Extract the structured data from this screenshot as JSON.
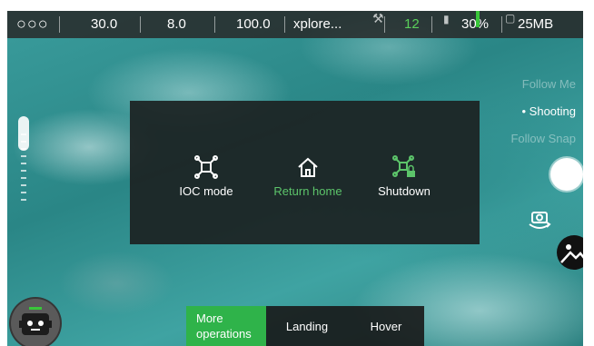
{
  "topbar": {
    "values": [
      "30.0",
      "8.0",
      "100.0",
      "xplore...",
      "12",
      "30%",
      "25MB"
    ]
  },
  "flight_modes": [
    {
      "label": "Follow Me",
      "active": false
    },
    {
      "label": "Shooting",
      "active": true
    },
    {
      "label": "Follow Snap",
      "active": false
    }
  ],
  "more_operations_panel": {
    "items": [
      {
        "label": "IOC mode",
        "icon": "ioc-drone-icon",
        "color": "#ffffff"
      },
      {
        "label": "Return home",
        "icon": "home-icon",
        "color": "#5cc46a"
      },
      {
        "label": "Shutdown",
        "icon": "drone-lock-icon",
        "color": "#ffffff"
      }
    ]
  },
  "bottom_bar": {
    "more_operations": "More operations",
    "landing": "Landing",
    "hover": "Hover"
  },
  "colors": {
    "accent_green": "#2fb34a",
    "return_home_green": "#5cc46a",
    "signal_green": "#5ad05a"
  }
}
